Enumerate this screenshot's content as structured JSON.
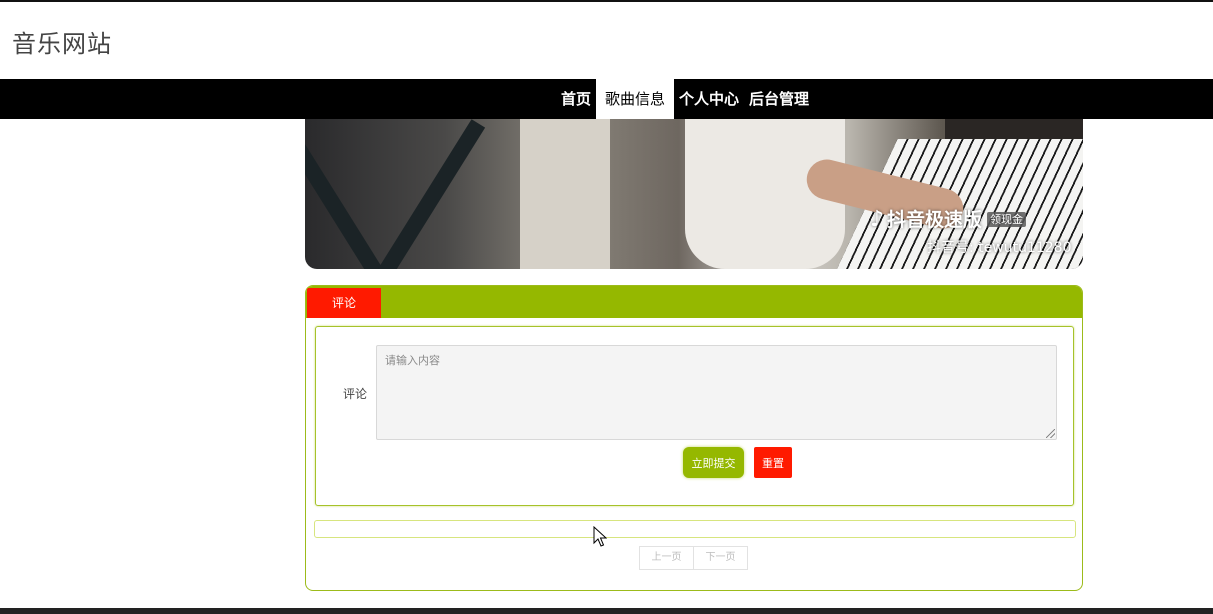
{
  "site": {
    "title": "音乐网站"
  },
  "nav": {
    "items": [
      {
        "label": "首页",
        "active": false
      },
      {
        "label": "歌曲信息",
        "active": true
      },
      {
        "label": "个人中心",
        "active": false
      },
      {
        "label": "后台管理",
        "active": false
      }
    ]
  },
  "video": {
    "watermark_brand": "抖音极速版",
    "watermark_badge": "领现金",
    "watermark_id": "抖音号: tewutu11280"
  },
  "comments": {
    "tab_label": "评论",
    "field_label": "评论",
    "placeholder": "请输入内容",
    "submit_label": "立即提交",
    "reset_label": "重置",
    "pager": {
      "prev_label": "上一页",
      "next_label": "下一页"
    }
  },
  "colors": {
    "nav_bg": "#000000",
    "accent_green": "#95b800",
    "accent_red": "#ff1a00"
  }
}
